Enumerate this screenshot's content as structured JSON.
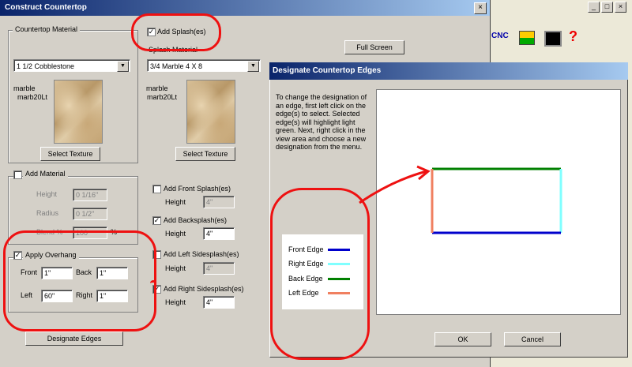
{
  "main_dialog": {
    "title": "Construct Countertop",
    "close_glyph": "×",
    "countertop_material": {
      "group_label": "Countertop Material",
      "selected": "1 1/2 Cobblestone",
      "texture_caption_1": "marble",
      "texture_caption_2": "marb20Lt",
      "select_texture_label": "Select Texture"
    },
    "add_material": {
      "label": "Add Material",
      "checked": false,
      "height_label": "Height",
      "height_value": "0 1/16\"",
      "radius_label": "Radius",
      "radius_value": "0 1/2\"",
      "blend_label": "Blend %",
      "blend_value": "100",
      "percent": "%"
    },
    "overhang": {
      "label": "Apply Overhang",
      "checked": true,
      "front_label": "Front",
      "front_value": "1\"",
      "back_label": "Back",
      "back_value": "1\"",
      "left_label": "Left",
      "left_value": "60\"",
      "right_label": "Right",
      "right_value": "1\""
    },
    "designate_edges_label": "Designate Edges",
    "add_splash": {
      "label": "Add Splash(es)",
      "checked": true,
      "material_label": "Splash Material",
      "selected": "3/4 Marble 4 X 8",
      "texture_caption_1": "marble",
      "texture_caption_2": "marb20Lt",
      "select_texture_label": "Select Texture"
    },
    "full_screen_label": "Full Screen",
    "splashes": [
      {
        "label": "Add Front Splash(es)",
        "checked": false,
        "height_label": "Height",
        "height_value": "4\"",
        "enabled": false
      },
      {
        "label": "Add Backsplash(es)",
        "checked": true,
        "height_label": "Height",
        "height_value": "4\"",
        "enabled": true
      },
      {
        "label": "Add Left Sidesplash(es)",
        "checked": false,
        "height_label": "Height",
        "height_value": "4\"",
        "enabled": false
      },
      {
        "label": "Add Right Sidesplash(es)",
        "checked": true,
        "height_label": "Height",
        "height_value": "4\"",
        "enabled": true
      }
    ],
    "combo_arrow": "▼",
    "check_glyph": "✓"
  },
  "designate_dialog": {
    "title": "Designate Countertop Edges",
    "instructions": "To change the designation of an edge, first left click on the edge(s) to select. Selected edge(s) will highlight light green. Next, right click in the view area and choose a new designation from the menu.",
    "legend": [
      {
        "label": "Front Edge",
        "color": "#0000cc"
      },
      {
        "label": "Right Edge",
        "color": "#80ffff"
      },
      {
        "label": "Back Edge",
        "color": "#008000"
      },
      {
        "label": "Left Edge",
        "color": "#f08060"
      }
    ],
    "ok_label": "OK",
    "cancel_label": "Cancel"
  },
  "background_app": {
    "minimize_glyph": "_",
    "restore_glyph": "□",
    "close_glyph": "×",
    "toolbar_cnc_label": "CNC",
    "help_glyph": "?"
  },
  "colors": {
    "title_bar": "#0a246a",
    "annotation_red": "#ee1111"
  }
}
